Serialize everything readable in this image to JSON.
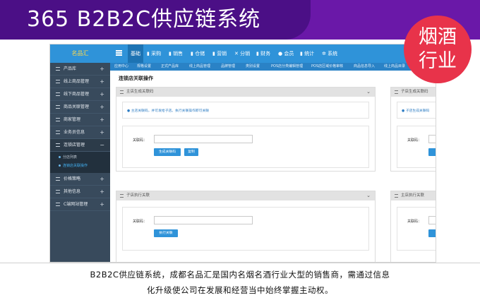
{
  "banner": {
    "title": "365 B2B2C供应链系统",
    "badge_line1": "烟酒",
    "badge_line2": "行业"
  },
  "app": {
    "logo": "名品汇",
    "topnav": [
      "基础",
      "采购",
      "销售",
      "仓储",
      "营销",
      "分销",
      "财务",
      "会员",
      "统计",
      "系统"
    ],
    "active_topnav": "基础",
    "subnav": [
      "应用中心",
      "规格设置",
      "正式产品库",
      "线上商品管理",
      "品牌管理",
      "类别设置",
      "POS店分类编辑管理",
      "POS店区域价格审核",
      "商品信息导入",
      "线上商品目录"
    ],
    "sidebar": [
      {
        "label": "产品库"
      },
      {
        "label": "线上商品管理"
      },
      {
        "label": "线下商品管理"
      },
      {
        "label": "商品关联管理"
      },
      {
        "label": "商家管理"
      },
      {
        "label": "业务员信息"
      },
      {
        "label": "连锁店管理"
      },
      {
        "label": "价格策略"
      },
      {
        "label": "其他信息"
      },
      {
        "label": "C端网站管理"
      }
    ],
    "sidebar_sub": [
      "分店列表",
      "连锁店关联操作"
    ],
    "page_title": "连锁店关联操作",
    "panel1": {
      "title": "主店生成关联码",
      "tip": "主店关联码，并可发给子店。执行关联操作即可关联",
      "label": "关联码：",
      "btn_generate": "生成关联码",
      "btn_copy": "复制"
    },
    "panel2": {
      "title": "子店执行关联",
      "label": "关联码：",
      "btn_exec": "执行关联"
    },
    "panel3": {
      "title": "子店生成关联码",
      "tip": "子店生成关联码",
      "label": "关联码："
    },
    "panel4": {
      "title": "主店执行关联",
      "label": "关联码："
    }
  },
  "caption": {
    "line1": "B2B2C供应链系统，成都名品汇是国内名烟名酒行业大型的销售商，需通过信息",
    "line2": "化升级使公司在发展和经营当中始终掌握主动权。"
  }
}
